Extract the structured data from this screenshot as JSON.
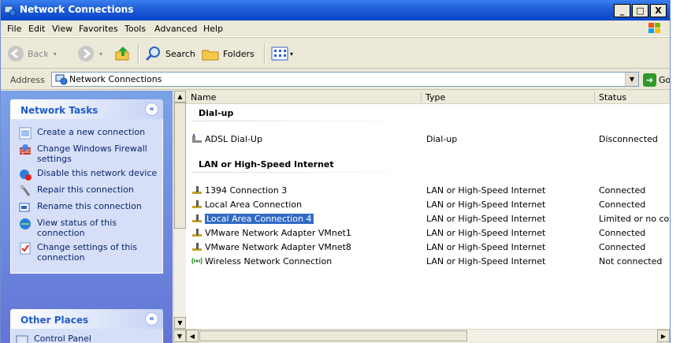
{
  "window": {
    "title": "Network Connections",
    "controls": {
      "minimize": "_",
      "maximize": "□",
      "close": "X"
    }
  },
  "menu": [
    "File",
    "Edit",
    "View",
    "Favorites",
    "Tools",
    "Advanced",
    "Help"
  ],
  "toolbar": {
    "back": "Back",
    "search": "Search",
    "folders": "Folders"
  },
  "address": {
    "label": "Address",
    "value": "Network Connections",
    "go": "Go"
  },
  "network_tasks": {
    "title": "Network Tasks",
    "items": [
      {
        "label": "Create a new connection",
        "icon": "new-connection-icon"
      },
      {
        "label": "Change Windows Firewall settings",
        "icon": "firewall-icon"
      },
      {
        "label": "Disable this network device",
        "icon": "disable-device-icon"
      },
      {
        "label": "Repair this connection",
        "icon": "repair-icon"
      },
      {
        "label": "Rename this connection",
        "icon": "rename-icon"
      },
      {
        "label": "View status of this connection",
        "icon": "status-icon"
      },
      {
        "label": "Change settings of this connection",
        "icon": "settings-icon"
      }
    ]
  },
  "other_places": {
    "title": "Other Places",
    "first_item": "Control Panel"
  },
  "list": {
    "columns": [
      "Name",
      "Type",
      "Status"
    ],
    "groups": [
      {
        "title": "Dial-up",
        "rows": [
          {
            "name": "ADSL Dial-Up",
            "type": "Dial-up",
            "status": "Disconnected",
            "icon": "dialup-icon"
          }
        ]
      },
      {
        "title": "LAN or High-Speed Internet",
        "rows": [
          {
            "name": "1394 Connection 3",
            "type": "LAN or High-Speed Internet",
            "status": "Connected",
            "icon": "lan-icon"
          },
          {
            "name": "Local Area Connection",
            "type": "LAN or High-Speed Internet",
            "status": "Connected",
            "icon": "lan-icon"
          },
          {
            "name": "Local Area Connection 4",
            "type": "LAN or High-Speed Internet",
            "status": "Limited or no conne",
            "icon": "lan-icon",
            "selected": true
          },
          {
            "name": "VMware Network Adapter VMnet1",
            "type": "LAN or High-Speed Internet",
            "status": "Connected",
            "icon": "lan-icon"
          },
          {
            "name": "VMware Network Adapter VMnet8",
            "type": "LAN or High-Speed Internet",
            "status": "Connected",
            "icon": "lan-icon"
          },
          {
            "name": "Wireless Network Connection",
            "type": "LAN or High-Speed Internet",
            "status": "Not connected",
            "icon": "wireless-icon"
          }
        ]
      }
    ]
  },
  "colors": {
    "titlebar": "#0a46c8",
    "task_pane": "#6f8ee0",
    "task_text": "#0a246a",
    "selection": "#316ac5"
  }
}
